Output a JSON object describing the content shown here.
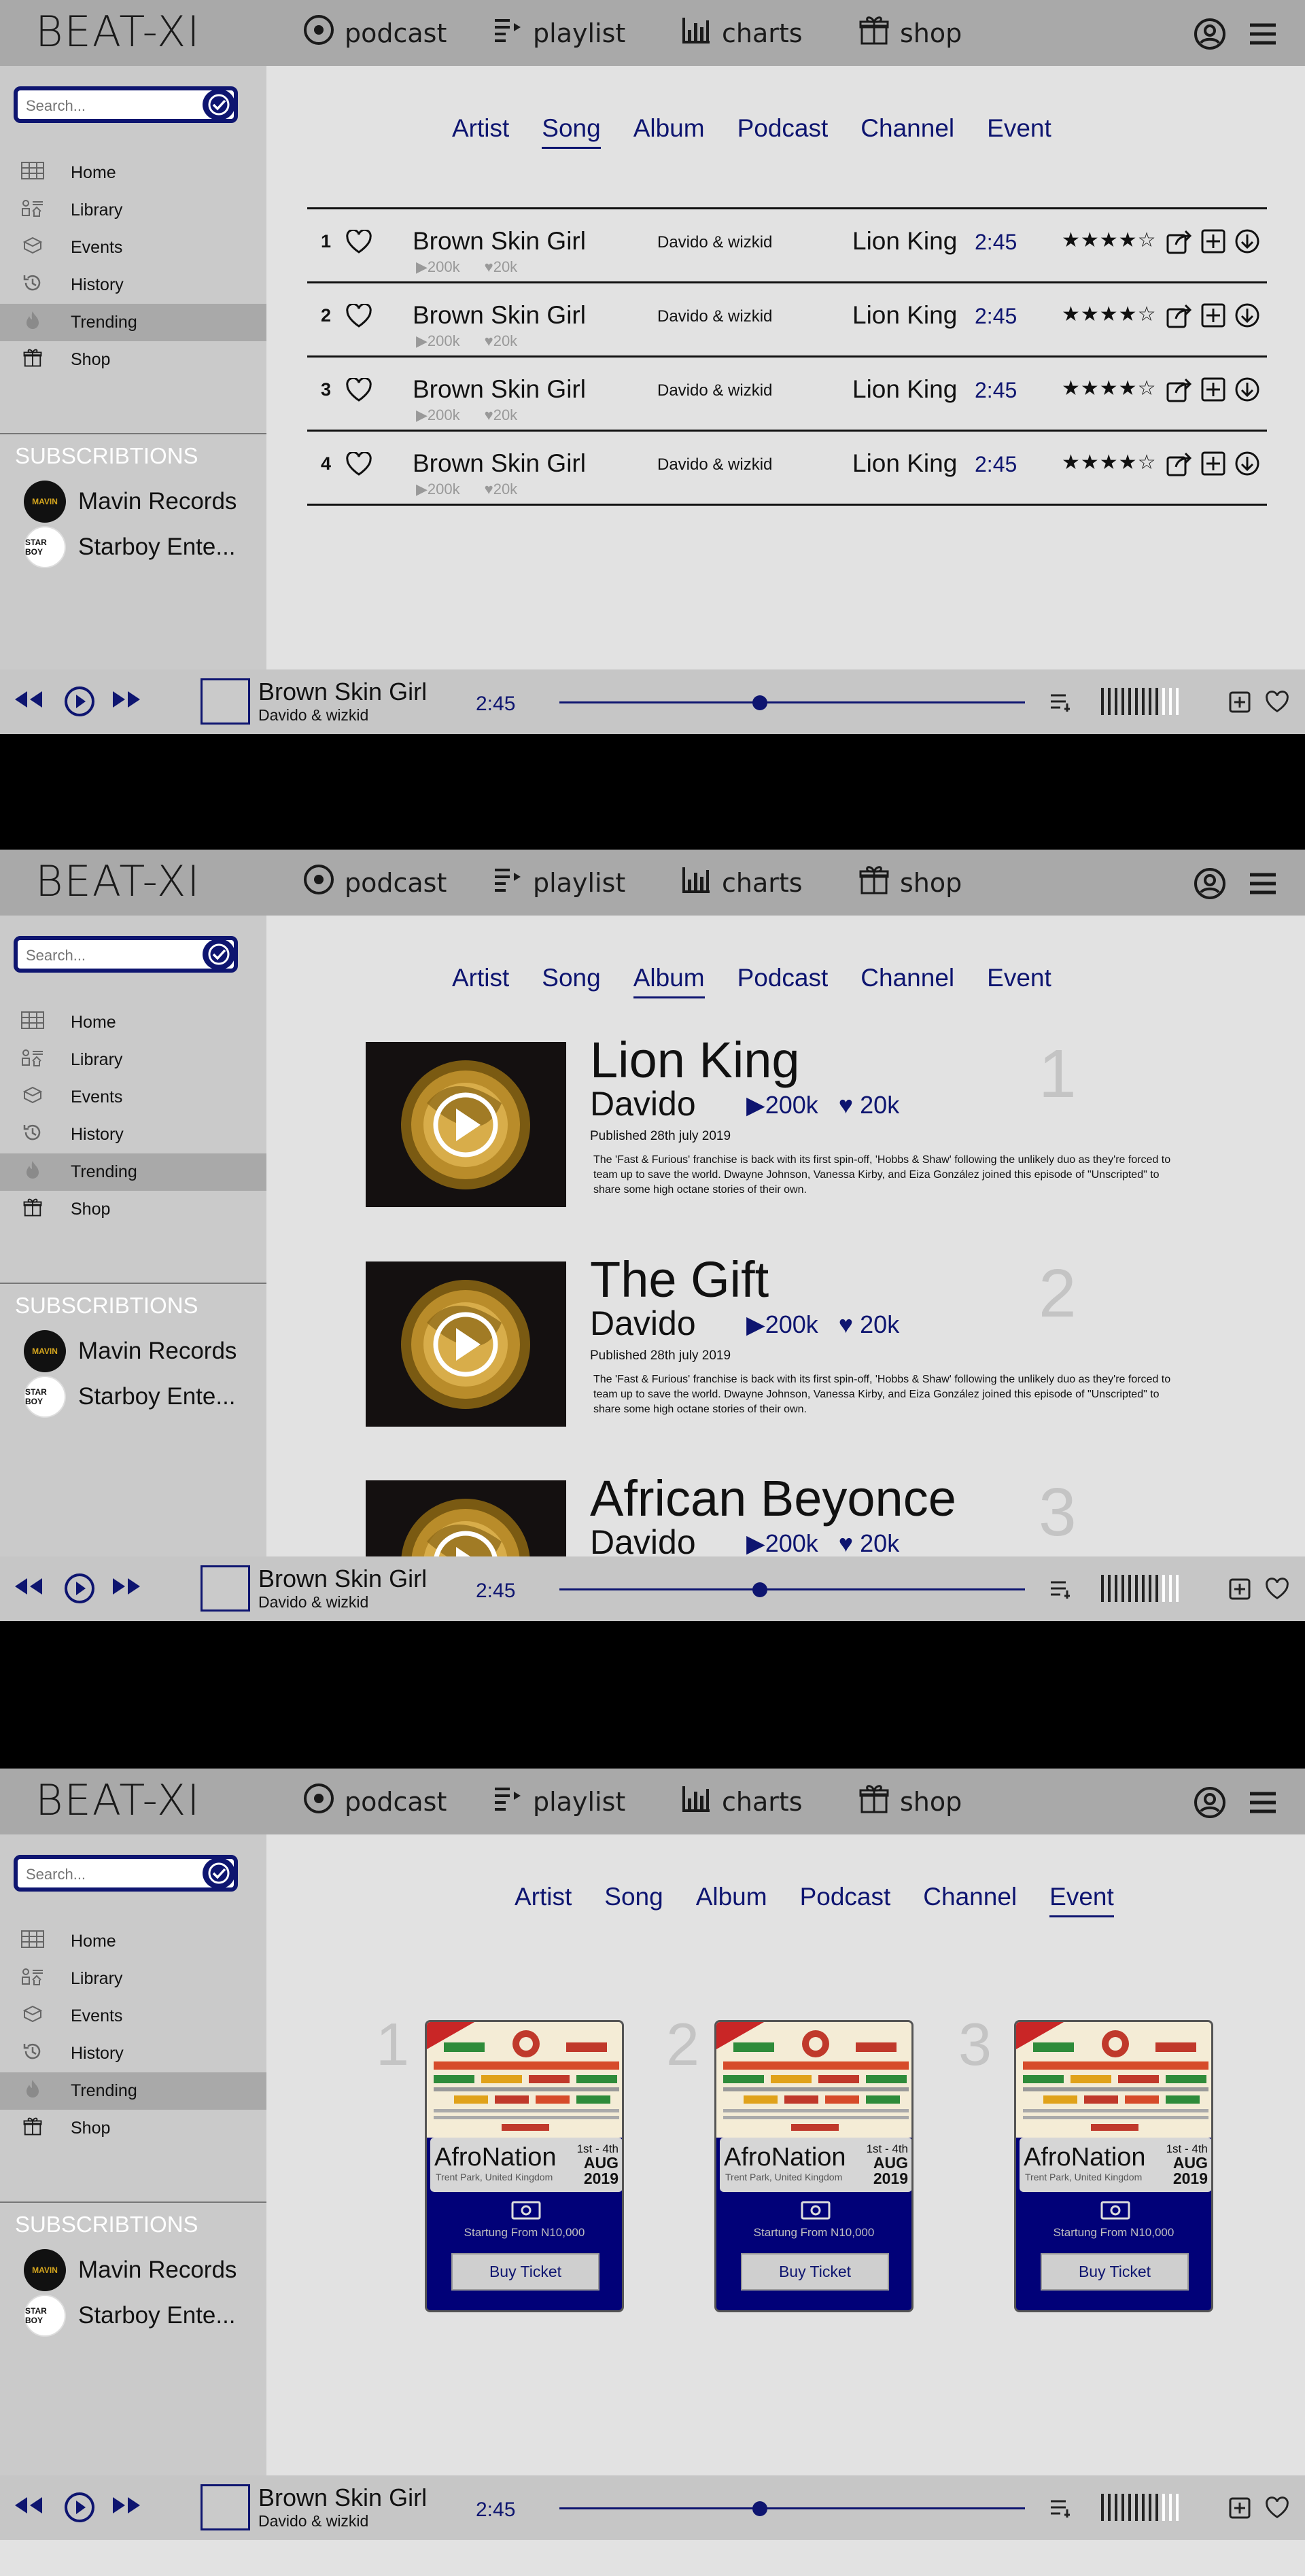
{
  "app": {
    "logo": "BEAT-XI",
    "nav": [
      {
        "label": "podcast",
        "icon": "disc-icon"
      },
      {
        "label": "playlist",
        "icon": "playlist-icon"
      },
      {
        "label": "charts",
        "icon": "bar-chart-icon"
      },
      {
        "label": "shop",
        "icon": "gift-icon"
      }
    ]
  },
  "sidebar": {
    "search_placeholder": "Search...",
    "items": [
      {
        "label": "Home",
        "icon": "grid-icon"
      },
      {
        "label": "Library",
        "icon": "library-icon"
      },
      {
        "label": "Events",
        "icon": "box-icon"
      },
      {
        "label": "History",
        "icon": "history-icon"
      },
      {
        "label": "Trending",
        "icon": "flame-icon",
        "active": true
      },
      {
        "label": "Shop",
        "icon": "gift-icon"
      }
    ],
    "subscriptions_title": "SUBSCRIBTIONS",
    "subscriptions": [
      {
        "name": "Mavin Records",
        "logo": "MAVIN"
      },
      {
        "name": "Starboy Ente...",
        "logo": "STAR BOY"
      }
    ]
  },
  "tabs": [
    "Artist",
    "Song",
    "Album",
    "Podcast",
    "Channel",
    "Event"
  ],
  "songs": [
    {
      "num": "1",
      "title": "Brown Skin Girl",
      "plays": "200k",
      "likes": "20k",
      "artist": "Davido & wizkid",
      "album": "Lion King",
      "duration": "2:45",
      "rating": 4
    },
    {
      "num": "2",
      "title": "Brown Skin Girl",
      "plays": "200k",
      "likes": "20k",
      "artist": "Davido & wizkid",
      "album": "Lion King",
      "duration": "2:45",
      "rating": 4
    },
    {
      "num": "3",
      "title": "Brown Skin Girl",
      "plays": "200k",
      "likes": "20k",
      "artist": "Davido & wizkid",
      "album": "Lion King",
      "duration": "2:45",
      "rating": 4
    },
    {
      "num": "4",
      "title": "Brown Skin Girl",
      "plays": "200k",
      "likes": "20k",
      "artist": "Davido & wizkid",
      "album": "Lion King",
      "duration": "2:45",
      "rating": 4
    }
  ],
  "albums": [
    {
      "title": "Lion King",
      "artist": "Davido",
      "plays": "200k",
      "likes": "20k",
      "published": "Published 28th july 2019",
      "description": "The 'Fast & Furious' franchise is back with its first spin-off, 'Hobbs & Shaw' following the unlikely duo as they're forced to team up to save the world.  Dwayne Johnson, Vanessa Kirby, and Eiza González joined this episode of \"Unscripted\" to share some high octane stories of their own.",
      "rank": "1"
    },
    {
      "title": "The Gift",
      "artist": "Davido",
      "plays": "200k",
      "likes": "20k",
      "published": "Published 28th july 2019",
      "description": "The 'Fast & Furious' franchise is back with its first spin-off, 'Hobbs & Shaw' following the unlikely duo as they're forced to team up to save the world.  Dwayne Johnson, Vanessa Kirby, and Eiza González joined this episode of \"Unscripted\" to share some high octane stories of their own.",
      "rank": "2"
    },
    {
      "title": "African Beyonce",
      "artist": "Davido",
      "plays": "200k",
      "likes": "20k",
      "rank": "3"
    }
  ],
  "events": [
    {
      "rank": "1",
      "name": "AfroNation",
      "location": "Trent Park, United Kingdom",
      "days": "1st - 4th",
      "month": "AUG",
      "year": "2019",
      "price": "Startung From N10,000",
      "button": "Buy Ticket"
    },
    {
      "rank": "2",
      "name": "AfroNation",
      "location": "Trent Park, United Kingdom",
      "days": "1st - 4th",
      "month": "AUG",
      "year": "2019",
      "price": "Startung From N10,000",
      "button": "Buy Ticket"
    },
    {
      "rank": "3",
      "name": "AfroNation",
      "location": "Trent Park, United Kingdom",
      "days": "1st - 4th",
      "month": "AUG",
      "year": "2019",
      "price": "Startung From N10,000",
      "button": "Buy Ticket"
    }
  ],
  "player": {
    "title": "Brown Skin Girl",
    "artist": "Davido & wizkid",
    "time": "2:45",
    "progress": 0.43,
    "volume_bars_on": 9,
    "volume_bars_total": 12
  },
  "colors": {
    "accent": "#0e1570",
    "topbar": "#a9a9a9",
    "sidebar": "#cacaca",
    "content": "#e2e2e2"
  }
}
